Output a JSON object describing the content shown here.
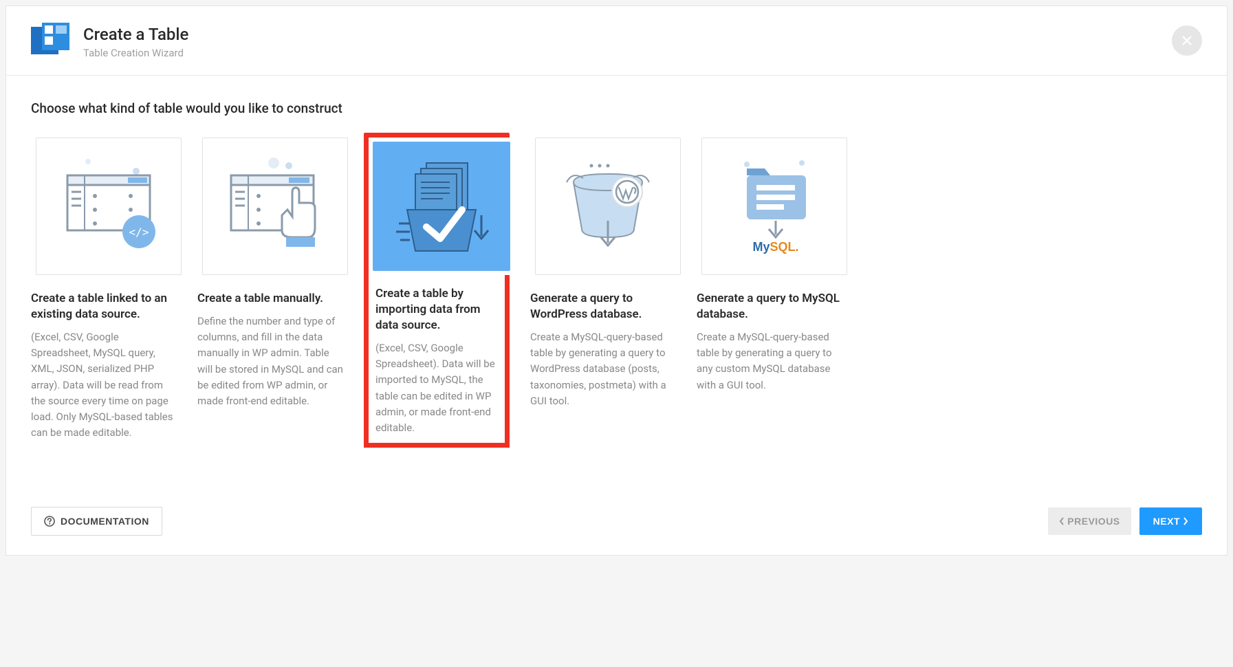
{
  "header": {
    "title": "Create a Table",
    "subtitle": "Table Creation Wizard"
  },
  "prompt": "Choose what kind of table would you like to construct",
  "options": [
    {
      "id": "linked",
      "title": "Create a table linked to an existing data source.",
      "desc": "(Excel, CSV, Google Spreadsheet, MySQL query, XML, JSON, serialized PHP array). Data will be read from the source every time on page load. Only MySQL-based tables can be made editable.",
      "selected": false,
      "icon": "code-window-icon"
    },
    {
      "id": "manual",
      "title": "Create a table manually.",
      "desc": "Define the number and type of columns, and fill in the data manually in WP admin. Table will be stored in MySQL and can be edited from WP admin, or made front-end editable.",
      "selected": false,
      "icon": "hand-pointer-icon"
    },
    {
      "id": "import",
      "title": "Create a table by importing data from data source.",
      "desc": "(Excel, CSV, Google Spreadsheet). Data will be imported to MySQL, the table can be edited in WP admin, or made front-end editable.",
      "selected": true,
      "icon": "import-check-icon"
    },
    {
      "id": "wpquery",
      "title": "Generate a query to WordPress database.",
      "desc": "Create a MySQL-query-based table by generating a query to WordPress database (posts, taxonomies, postmeta) with a GUI tool.",
      "selected": false,
      "icon": "wordpress-db-icon"
    },
    {
      "id": "mysqlquery",
      "title": "Generate a query to MySQL database.",
      "desc": "Create a MySQL-query-based table by generating a query to any custom MySQL database with a GUI tool.",
      "selected": false,
      "icon": "mysql-db-icon"
    }
  ],
  "footer": {
    "documentation_label": "DOCUMENTATION",
    "previous_label": "PREVIOUS",
    "next_label": "NEXT"
  },
  "colors": {
    "highlight_border": "#ef2f22",
    "selected_bg": "#62aef3",
    "primary_btn": "#1f9aff"
  }
}
